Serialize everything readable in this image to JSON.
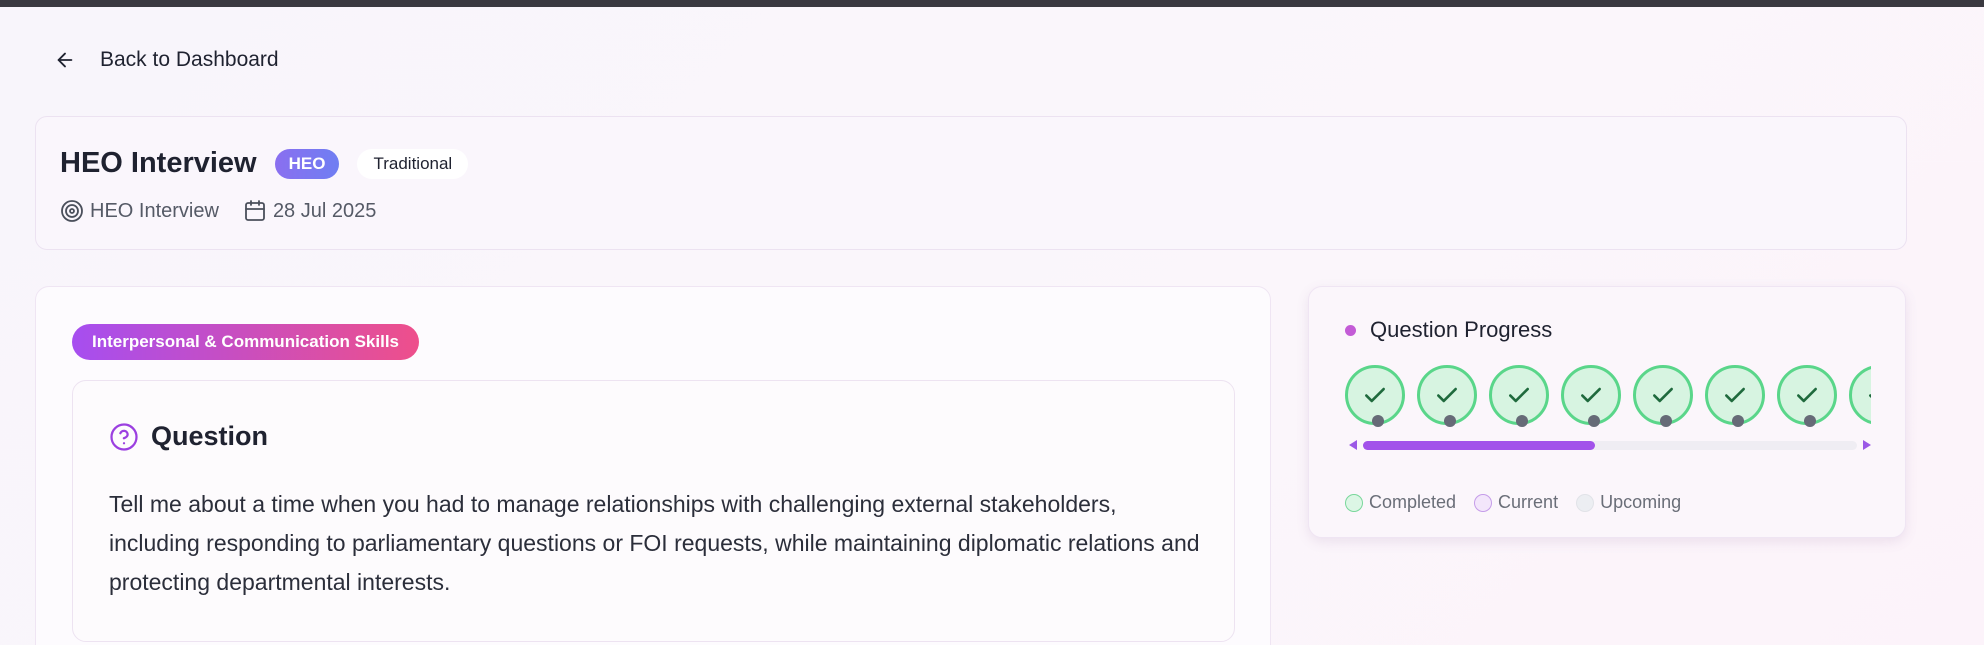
{
  "nav": {
    "back_label": "Back to Dashboard"
  },
  "interview": {
    "title": "HEO Interview",
    "grade_badge": "HEO",
    "type_badge": "Traditional",
    "meta_name": "HEO Interview",
    "meta_date": "28 Jul 2025"
  },
  "question": {
    "category": "Interpersonal & Communication Skills",
    "heading": "Question",
    "text": "Tell me about a time when you had to manage relationships with challenging external stakeholders, including responding to parliamentary questions or FOI requests, while maintaining diplomatic relations and protecting departmental interests."
  },
  "progress": {
    "heading": "Question Progress",
    "steps": [
      {
        "status": "completed",
        "icon": "check-icon"
      },
      {
        "status": "completed",
        "icon": "check-icon"
      },
      {
        "status": "completed",
        "icon": "check-icon"
      },
      {
        "status": "completed",
        "icon": "check-icon"
      },
      {
        "status": "completed",
        "icon": "check-icon"
      },
      {
        "status": "completed",
        "icon": "check-icon"
      },
      {
        "status": "completed",
        "icon": "check-icon"
      },
      {
        "status": "completed",
        "icon": "check-icon"
      }
    ],
    "scroll_fraction": 0.47,
    "legend": {
      "completed": "Completed",
      "current": "Current",
      "upcoming": "Upcoming"
    }
  },
  "colors": {
    "accent_purple": "#a252ea",
    "completed_green": "#5ad68a",
    "category_gradient_start": "#a64ef0",
    "category_gradient_end": "#ee4f8b"
  }
}
